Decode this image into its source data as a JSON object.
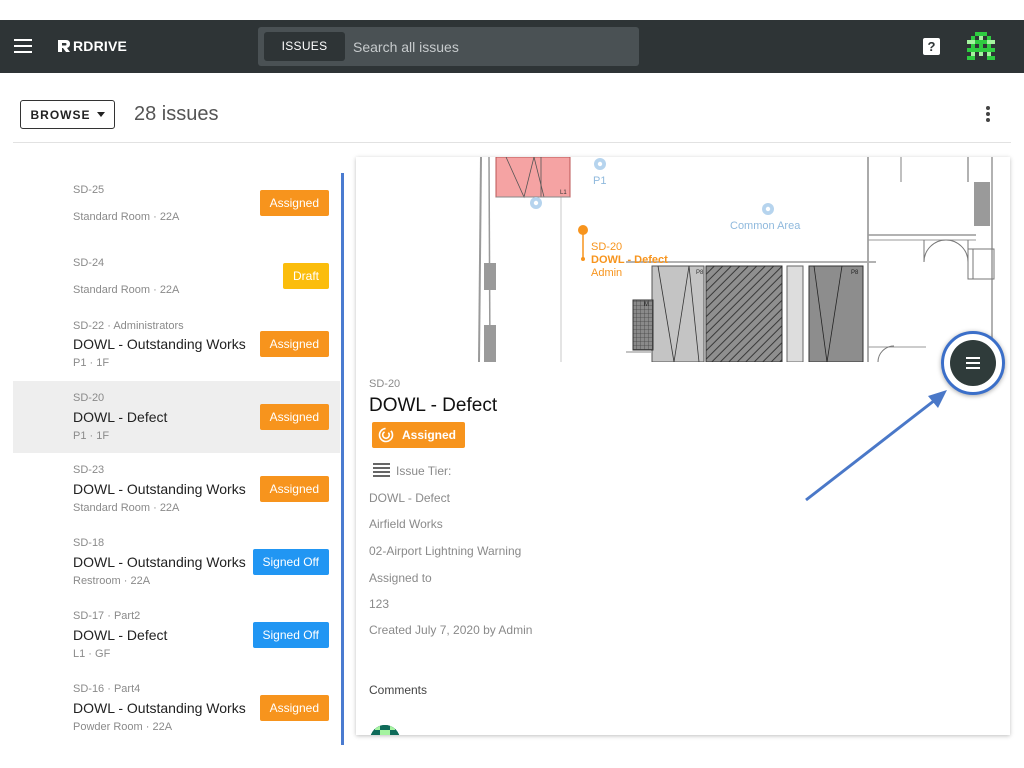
{
  "header": {
    "logo_text": "RDRIVE",
    "search_scope": "ISSUES",
    "search_placeholder": "Search all issues"
  },
  "toolbar": {
    "browse_label": "BROWSE",
    "issue_count": "28 issues"
  },
  "issues": [
    {
      "ref": "SD-25",
      "title": "",
      "location": "Standard Room · 22A",
      "status": "Assigned"
    },
    {
      "ref": "SD-24",
      "title": "",
      "location": "Standard Room · 22A",
      "status": "Draft"
    },
    {
      "ref": "SD-22 · Administrators",
      "title": "DOWL - Outstanding Works",
      "location": "P1 · 1F",
      "status": "Assigned"
    },
    {
      "ref": "SD-20",
      "title": "DOWL - Defect",
      "location": "P1 · 1F",
      "status": "Assigned"
    },
    {
      "ref": "SD-23",
      "title": "DOWL - Outstanding Works",
      "location": "Standard Room · 22A",
      "status": "Assigned"
    },
    {
      "ref": "SD-18",
      "title": "DOWL - Outstanding Works",
      "location": "Restroom · 22A",
      "status": "Signed Off"
    },
    {
      "ref": "SD-17 · Part2",
      "title": "DOWL - Defect",
      "location": "L1 · GF",
      "status": "Signed Off"
    },
    {
      "ref": "SD-16 · Part4",
      "title": "DOWL - Outstanding Works",
      "location": "Powder Room · 22A",
      "status": "Assigned"
    }
  ],
  "plan": {
    "pin_ref": "SD-20",
    "pin_title": "DOWL - Defect",
    "pin_user": "Admin",
    "label_p1": "P1",
    "label_common": "Common Area",
    "label_l1": "L1",
    "label_p8a": "P8",
    "label_p8b": "P8",
    "label_m": "M"
  },
  "detail": {
    "ref": "SD-20",
    "title": "DOWL - Defect",
    "status": "Assigned",
    "tier_label": "Issue Tier:",
    "type": "DOWL - Defect",
    "works": "Airfield Works",
    "category": "02-Airport Lightning Warning",
    "assigned_label": "Assigned to",
    "assigned_value": "123",
    "created": "Created July 7, 2020 by Admin",
    "comments_label": "Comments"
  },
  "colors": {
    "topbar": "#2e3436",
    "assigned": "#f7941d",
    "draft": "#fbbd0c",
    "signed_off": "#2196f3",
    "highlight": "#3b6fc9"
  },
  "icons": [
    "menu-icon",
    "rdrive-logo-icon",
    "help-icon",
    "user-avatar-icon",
    "caret-down-icon",
    "more-vert-icon",
    "location-pin-icon",
    "status-assigned-icon",
    "issue-tier-icon",
    "fab-menu-icon"
  ]
}
